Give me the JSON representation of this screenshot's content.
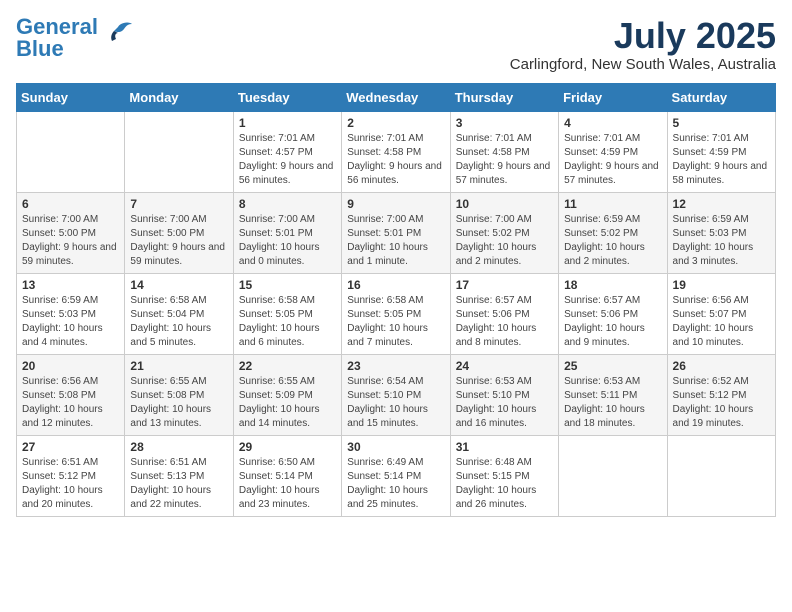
{
  "header": {
    "logo_general": "General",
    "logo_blue": "Blue",
    "month_title": "July 2025",
    "subtitle": "Carlingford, New South Wales, Australia"
  },
  "weekdays": [
    "Sunday",
    "Monday",
    "Tuesday",
    "Wednesday",
    "Thursday",
    "Friday",
    "Saturday"
  ],
  "weeks": [
    [
      {
        "day": "",
        "info": ""
      },
      {
        "day": "",
        "info": ""
      },
      {
        "day": "1",
        "info": "Sunrise: 7:01 AM\nSunset: 4:57 PM\nDaylight: 9 hours and 56 minutes."
      },
      {
        "day": "2",
        "info": "Sunrise: 7:01 AM\nSunset: 4:58 PM\nDaylight: 9 hours and 56 minutes."
      },
      {
        "day": "3",
        "info": "Sunrise: 7:01 AM\nSunset: 4:58 PM\nDaylight: 9 hours and 57 minutes."
      },
      {
        "day": "4",
        "info": "Sunrise: 7:01 AM\nSunset: 4:59 PM\nDaylight: 9 hours and 57 minutes."
      },
      {
        "day": "5",
        "info": "Sunrise: 7:01 AM\nSunset: 4:59 PM\nDaylight: 9 hours and 58 minutes."
      }
    ],
    [
      {
        "day": "6",
        "info": "Sunrise: 7:00 AM\nSunset: 5:00 PM\nDaylight: 9 hours and 59 minutes."
      },
      {
        "day": "7",
        "info": "Sunrise: 7:00 AM\nSunset: 5:00 PM\nDaylight: 9 hours and 59 minutes."
      },
      {
        "day": "8",
        "info": "Sunrise: 7:00 AM\nSunset: 5:01 PM\nDaylight: 10 hours and 0 minutes."
      },
      {
        "day": "9",
        "info": "Sunrise: 7:00 AM\nSunset: 5:01 PM\nDaylight: 10 hours and 1 minute."
      },
      {
        "day": "10",
        "info": "Sunrise: 7:00 AM\nSunset: 5:02 PM\nDaylight: 10 hours and 2 minutes."
      },
      {
        "day": "11",
        "info": "Sunrise: 6:59 AM\nSunset: 5:02 PM\nDaylight: 10 hours and 2 minutes."
      },
      {
        "day": "12",
        "info": "Sunrise: 6:59 AM\nSunset: 5:03 PM\nDaylight: 10 hours and 3 minutes."
      }
    ],
    [
      {
        "day": "13",
        "info": "Sunrise: 6:59 AM\nSunset: 5:03 PM\nDaylight: 10 hours and 4 minutes."
      },
      {
        "day": "14",
        "info": "Sunrise: 6:58 AM\nSunset: 5:04 PM\nDaylight: 10 hours and 5 minutes."
      },
      {
        "day": "15",
        "info": "Sunrise: 6:58 AM\nSunset: 5:05 PM\nDaylight: 10 hours and 6 minutes."
      },
      {
        "day": "16",
        "info": "Sunrise: 6:58 AM\nSunset: 5:05 PM\nDaylight: 10 hours and 7 minutes."
      },
      {
        "day": "17",
        "info": "Sunrise: 6:57 AM\nSunset: 5:06 PM\nDaylight: 10 hours and 8 minutes."
      },
      {
        "day": "18",
        "info": "Sunrise: 6:57 AM\nSunset: 5:06 PM\nDaylight: 10 hours and 9 minutes."
      },
      {
        "day": "19",
        "info": "Sunrise: 6:56 AM\nSunset: 5:07 PM\nDaylight: 10 hours and 10 minutes."
      }
    ],
    [
      {
        "day": "20",
        "info": "Sunrise: 6:56 AM\nSunset: 5:08 PM\nDaylight: 10 hours and 12 minutes."
      },
      {
        "day": "21",
        "info": "Sunrise: 6:55 AM\nSunset: 5:08 PM\nDaylight: 10 hours and 13 minutes."
      },
      {
        "day": "22",
        "info": "Sunrise: 6:55 AM\nSunset: 5:09 PM\nDaylight: 10 hours and 14 minutes."
      },
      {
        "day": "23",
        "info": "Sunrise: 6:54 AM\nSunset: 5:10 PM\nDaylight: 10 hours and 15 minutes."
      },
      {
        "day": "24",
        "info": "Sunrise: 6:53 AM\nSunset: 5:10 PM\nDaylight: 10 hours and 16 minutes."
      },
      {
        "day": "25",
        "info": "Sunrise: 6:53 AM\nSunset: 5:11 PM\nDaylight: 10 hours and 18 minutes."
      },
      {
        "day": "26",
        "info": "Sunrise: 6:52 AM\nSunset: 5:12 PM\nDaylight: 10 hours and 19 minutes."
      }
    ],
    [
      {
        "day": "27",
        "info": "Sunrise: 6:51 AM\nSunset: 5:12 PM\nDaylight: 10 hours and 20 minutes."
      },
      {
        "day": "28",
        "info": "Sunrise: 6:51 AM\nSunset: 5:13 PM\nDaylight: 10 hours and 22 minutes."
      },
      {
        "day": "29",
        "info": "Sunrise: 6:50 AM\nSunset: 5:14 PM\nDaylight: 10 hours and 23 minutes."
      },
      {
        "day": "30",
        "info": "Sunrise: 6:49 AM\nSunset: 5:14 PM\nDaylight: 10 hours and 25 minutes."
      },
      {
        "day": "31",
        "info": "Sunrise: 6:48 AM\nSunset: 5:15 PM\nDaylight: 10 hours and 26 minutes."
      },
      {
        "day": "",
        "info": ""
      },
      {
        "day": "",
        "info": ""
      }
    ]
  ]
}
